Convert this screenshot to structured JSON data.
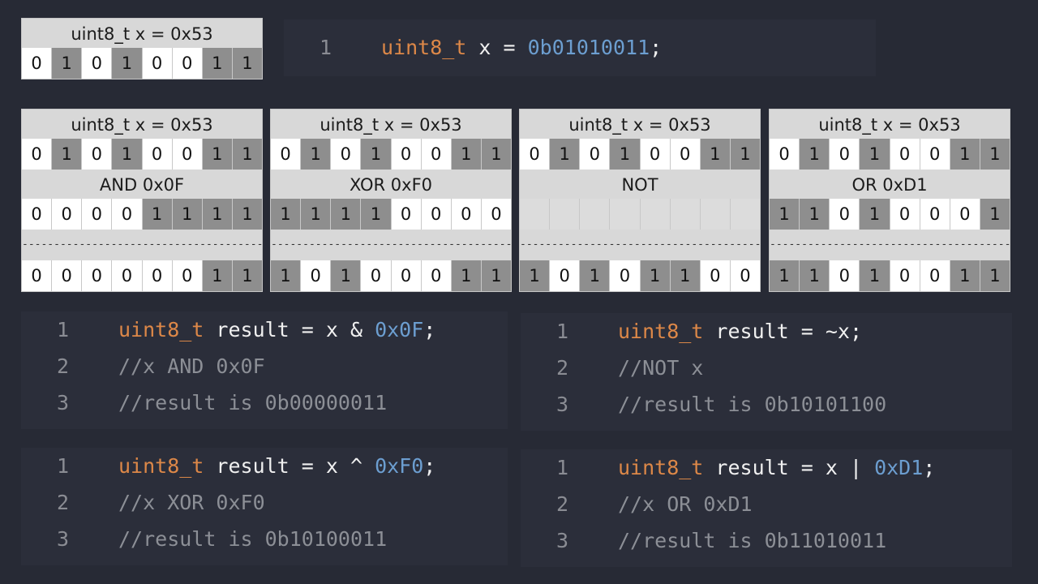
{
  "top_box": {
    "header": "uint8_t x = 0x53",
    "bits": [
      "0",
      "1",
      "0",
      "1",
      "0",
      "0",
      "1",
      "1"
    ]
  },
  "top_code": {
    "line_no": "1",
    "type": "uint8_t",
    "var": " x = ",
    "value": "0b01010011",
    "semi": ";"
  },
  "panels": [
    {
      "header": "uint8_t x = 0x53",
      "x_bits": [
        "0",
        "1",
        "0",
        "1",
        "0",
        "0",
        "1",
        "1"
      ],
      "op_label": "AND 0x0F",
      "op_bits": [
        "0",
        "0",
        "0",
        "0",
        "1",
        "1",
        "1",
        "1"
      ],
      "separator": "-------------------------------------------------------",
      "result_bits": [
        "0",
        "0",
        "0",
        "0",
        "0",
        "0",
        "1",
        "1"
      ]
    },
    {
      "header": "uint8_t x = 0x53",
      "x_bits": [
        "0",
        "1",
        "0",
        "1",
        "0",
        "0",
        "1",
        "1"
      ],
      "op_label": "XOR 0xF0",
      "op_bits": [
        "1",
        "1",
        "1",
        "1",
        "0",
        "0",
        "0",
        "0"
      ],
      "separator": "-------------------------------------------------------",
      "result_bits": [
        "1",
        "0",
        "1",
        "0",
        "0",
        "0",
        "1",
        "1"
      ]
    },
    {
      "header": "uint8_t x = 0x53",
      "x_bits": [
        "0",
        "1",
        "0",
        "1",
        "0",
        "0",
        "1",
        "1"
      ],
      "op_label": "NOT",
      "op_bits": [
        "",
        "",
        "",
        "",
        "",
        "",
        "",
        ""
      ],
      "separator": "-------------------------------------------------------",
      "result_bits": [
        "1",
        "0",
        "1",
        "0",
        "1",
        "1",
        "0",
        "0"
      ]
    },
    {
      "header": "uint8_t x = 0x53",
      "x_bits": [
        "0",
        "1",
        "0",
        "1",
        "0",
        "0",
        "1",
        "1"
      ],
      "op_label": "OR 0xD1",
      "op_bits": [
        "1",
        "1",
        "0",
        "1",
        "0",
        "0",
        "0",
        "1"
      ],
      "separator": "-------------------------------------------------------",
      "result_bits": [
        "1",
        "1",
        "0",
        "1",
        "0",
        "0",
        "1",
        "1"
      ]
    }
  ],
  "code_and": {
    "l1": {
      "n": "1",
      "type": "uint8_t",
      "mid": " result = x & ",
      "num": "0x0F",
      "end": ";"
    },
    "l2": {
      "n": "2",
      "comment": "//x AND 0x0F"
    },
    "l3": {
      "n": "3",
      "comment": "//result is 0b00000011"
    }
  },
  "code_not": {
    "l1": {
      "n": "1",
      "type": "uint8_t",
      "mid": " result = ~x;"
    },
    "l2": {
      "n": "2",
      "comment": "//NOT x"
    },
    "l3": {
      "n": "3",
      "comment": "//result is 0b10101100"
    }
  },
  "code_xor": {
    "l1": {
      "n": "1",
      "type": "uint8_t",
      "mid": " result = x ^ ",
      "num": "0xF0",
      "end": ";"
    },
    "l2": {
      "n": "2",
      "comment": "//x XOR 0xF0"
    },
    "l3": {
      "n": "3",
      "comment": "//result is 0b10100011"
    }
  },
  "code_or": {
    "l1": {
      "n": "1",
      "type": "uint8_t",
      "mid": " result = x | ",
      "num": "0xD1",
      "end": ";"
    },
    "l2": {
      "n": "2",
      "comment": "//x OR 0xD1"
    },
    "l3": {
      "n": "3",
      "comment": "//result is 0b11010011"
    }
  }
}
